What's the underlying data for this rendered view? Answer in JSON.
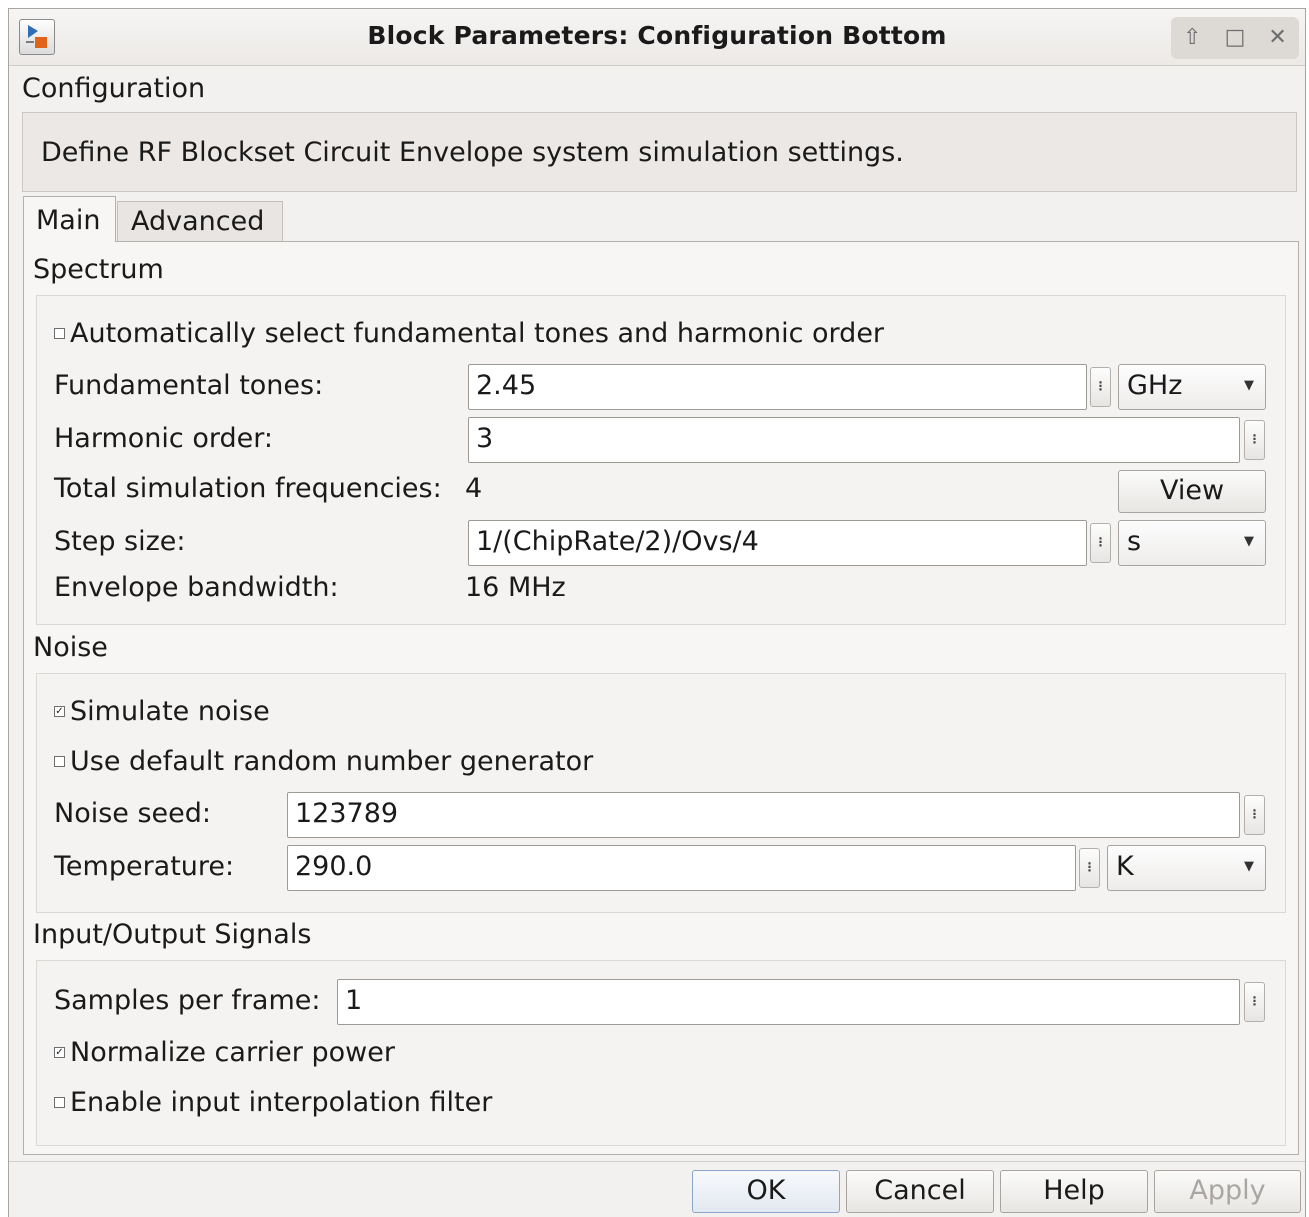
{
  "window": {
    "title": "Block Parameters: Configuration Bottom"
  },
  "header": {
    "block_name": "Configuration",
    "description": "Define RF Blockset Circuit Envelope system simulation settings."
  },
  "tabs": [
    {
      "label": "Main",
      "selected": true
    },
    {
      "label": "Advanced",
      "selected": false
    }
  ],
  "spectrum": {
    "title": "Spectrum",
    "auto_select": {
      "label": "Automatically select fundamental tones and harmonic order",
      "checked": false
    },
    "fundamental_tones": {
      "label": "Fundamental tones:",
      "value": "2.45",
      "unit": "GHz"
    },
    "harmonic_order": {
      "label": "Harmonic order:",
      "value": "3"
    },
    "total_freqs": {
      "label": "Total simulation frequencies:",
      "value": "4",
      "view_label": "View"
    },
    "step_size": {
      "label": "Step size:",
      "value": "1/(ChipRate/2)/Ovs/4",
      "unit": "s"
    },
    "envelope_bw": {
      "label": "Envelope bandwidth:",
      "value": "16 MHz"
    }
  },
  "noise": {
    "title": "Noise",
    "simulate_noise": {
      "label": "Simulate noise",
      "checked": true
    },
    "default_rng": {
      "label": "Use default random number generator",
      "checked": false
    },
    "noise_seed": {
      "label": "Noise seed:",
      "value": "123789"
    },
    "temperature": {
      "label": "Temperature:",
      "value": "290.0",
      "unit": "K"
    }
  },
  "io": {
    "title": "Input/Output Signals",
    "samples_per_frame": {
      "label": "Samples per frame:",
      "value": "1"
    },
    "normalize_power": {
      "label": "Normalize carrier power",
      "checked": true
    },
    "interp_filter": {
      "label": "Enable input interpolation filter",
      "checked": false
    }
  },
  "buttons": {
    "ok": "OK",
    "cancel": "Cancel",
    "help": "Help",
    "apply": "Apply"
  },
  "icons": {
    "app": "simulink-block-icon",
    "rollup": "arrow-up-icon",
    "maximize": "maximize-icon",
    "close": "close-icon",
    "dots": "more-options-icon",
    "dropdown": "chevron-down-icon"
  },
  "colors": {
    "accent": "#8aa6c8",
    "disabled_text": "#a9a6a3",
    "app_icon_blue": "#2f6db5",
    "app_icon_orange": "#e0621b"
  }
}
